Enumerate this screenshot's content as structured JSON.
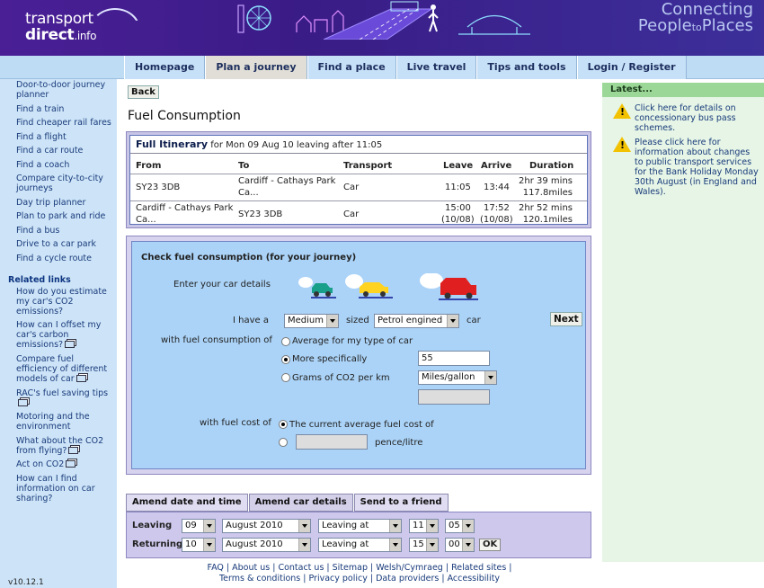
{
  "header": {
    "logo_line1": "transport",
    "logo_line2": "direct",
    "logo_suffix": ".info",
    "tagline_line1": "Connecting",
    "tagline_people": "People",
    "tagline_to": "to",
    "tagline_places": "Places"
  },
  "nav": {
    "tabs": [
      {
        "label": "Homepage"
      },
      {
        "label": "Plan a journey"
      },
      {
        "label": "Find a place"
      },
      {
        "label": "Live travel"
      },
      {
        "label": "Tips and tools"
      },
      {
        "label": "Login / Register"
      }
    ]
  },
  "leftnav": {
    "items": [
      "Door-to-door journey planner",
      "Find a train",
      "Find cheaper rail fares",
      "Find a flight",
      "Find a car route",
      "Find a coach",
      "Compare city-to-city journeys",
      "Day trip planner",
      "Plan to park and ride",
      "Find a bus",
      "Drive to a car park",
      "Find a cycle route"
    ],
    "related_heading": "Related links",
    "related": [
      "How do you estimate my car's CO2 emissions?",
      "How can I offset my car's carbon emissions?",
      "Compare fuel efficiency of different models of car",
      "RAC's fuel saving tips",
      "Motoring and the environment",
      "What about the CO2 from flying?",
      "Act on CO2",
      "How can I find information on car sharing?"
    ],
    "version": "v10.12.1"
  },
  "right": {
    "heading": "Latest...",
    "items": [
      "Click here for details on concessionary bus pass schemes.",
      "Please click here for information about changes to public transport services for the Bank Holiday Monday 30th August (in England and Wales)."
    ]
  },
  "main": {
    "back_label": "Back",
    "title": "Fuel Consumption",
    "itinerary": {
      "heading": "Full Itinerary",
      "subheading": "for Mon 09 Aug 10 leaving after 11:05",
      "columns": [
        "From",
        "To",
        "Transport",
        "Leave",
        "Arrive",
        "Duration"
      ],
      "rows": [
        {
          "from": "SY23 3DB",
          "to1": "Cardiff - Cathays Park",
          "to2": "Ca...",
          "transport": "Car",
          "leave1": "11:05",
          "leave2": "",
          "arrive1": "13:44",
          "arrive2": "",
          "dur1": "2hr 39 mins",
          "dur2": "117.8miles"
        },
        {
          "from": "Cardiff - Cathays Park",
          "from2": "Ca...",
          "to1": "SY23 3DB",
          "to2": "",
          "transport": "Car",
          "leave1": "15:00",
          "leave2": "(10/08)",
          "arrive1": "17:52",
          "arrive2": "(10/08)",
          "dur1": "2hr 52 mins",
          "dur2": "120.1miles"
        }
      ]
    },
    "fuel": {
      "heading": "Check fuel consumption (for your journey)",
      "car_details_label": "Enter your car details",
      "i_have_a": "I have a",
      "size_value": "Medium",
      "sized": "sized",
      "engine_value": "Petrol engined",
      "car": "car",
      "next_label": "Next",
      "consumption_label": "with fuel consumption of",
      "opt_average": "Average for my type of car",
      "opt_specific": "More specifically",
      "specific_value": "55",
      "opt_grams": "Grams of CO2 per km",
      "unit_value": "Miles/gallon",
      "cost_label": "with fuel cost of",
      "opt_current_cost": "The current average fuel cost of",
      "pence_label": "pence/litre"
    },
    "subtabs": [
      "Amend date and time",
      "Amend car details",
      "Send to a friend"
    ],
    "amend": {
      "leaving_label": "Leaving",
      "returning_label": "Returning",
      "leaving": {
        "day": "09",
        "month": "August 2010",
        "type": "Leaving at",
        "hour": "11",
        "min": "05"
      },
      "returning": {
        "day": "10",
        "month": "August 2010",
        "type": "Leaving at",
        "hour": "15",
        "min": "00"
      },
      "ok_label": "OK"
    }
  },
  "footer": {
    "line1": "FAQ | About us | Contact us | Sitemap | Welsh/Cymraeg | Related sites |",
    "line2": "Terms & conditions | Privacy policy | Data providers | Accessibility"
  },
  "colors": {
    "header_bg": "#4a1f96",
    "nav_bg": "#bfdcf5",
    "panel_bg": "#abd3f7",
    "latest_bg": "#9bd897",
    "link": "#183a7a"
  }
}
